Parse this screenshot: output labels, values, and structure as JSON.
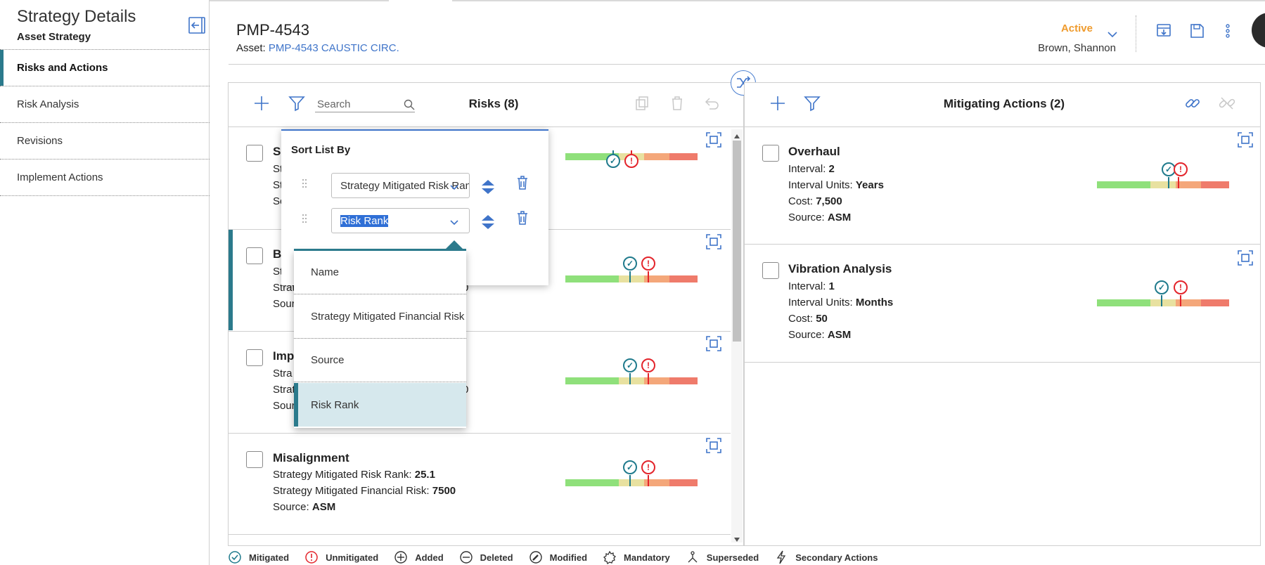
{
  "sidebar": {
    "title": "Strategy Details",
    "subtitle": "Asset Strategy",
    "items": [
      {
        "label": "Risks and Actions",
        "active": true
      },
      {
        "label": "Risk Analysis"
      },
      {
        "label": "Revisions"
      },
      {
        "label": "Implement Actions"
      }
    ]
  },
  "header": {
    "id": "PMP-4543",
    "asset_label": "Asset:",
    "asset_link": "PMP-4543 CAUSTIC CIRC.",
    "status": "Active",
    "owner": "Brown, Shannon"
  },
  "risks": {
    "title": "Risks (8)",
    "search_placeholder": "Search",
    "cards": [
      {
        "title": "S",
        "lines": [
          "Str",
          "Str",
          "Sou"
        ]
      },
      {
        "title": "B",
        "lines": [
          "St",
          "Strat",
          "Sour"
        ],
        "selected": true,
        "trail": [
          "",
          "0",
          ""
        ]
      },
      {
        "title": "Imp",
        "lines": [
          "Stra",
          "Strat",
          "Sour"
        ],
        "trail": [
          "",
          "0",
          ""
        ]
      },
      {
        "title": "Misalignment",
        "lines": [
          {
            "label": "Strategy Mitigated Risk Rank:",
            "value": "25.1"
          },
          {
            "label": "Strategy Mitigated Financial Risk:",
            "value": "7500"
          },
          {
            "label": "Source:",
            "value": "ASM"
          }
        ]
      }
    ]
  },
  "actions": {
    "title": "Mitigating Actions (2)",
    "cards": [
      {
        "title": "Overhaul",
        "lines": [
          {
            "label": "Interval:",
            "value": "2"
          },
          {
            "label": "Interval Units:",
            "value": "Years"
          },
          {
            "label": "Cost:",
            "value": "7,500"
          },
          {
            "label": "Source:",
            "value": "ASM"
          }
        ]
      },
      {
        "title": "Vibration Analysis",
        "lines": [
          {
            "label": "Interval:",
            "value": "1"
          },
          {
            "label": "Interval Units:",
            "value": "Months"
          },
          {
            "label": "Cost:",
            "value": "50"
          },
          {
            "label": "Source:",
            "value": "ASM"
          }
        ]
      }
    ]
  },
  "sort_popup": {
    "title": "Sort List By",
    "field1": "Strategy Mitigated Risk Rank",
    "field2": "Risk Rank",
    "options": [
      "Name",
      "Strategy Mitigated Financial Risk",
      "Source",
      "Risk Rank"
    ],
    "selected_option": "Risk Rank"
  },
  "legend": [
    "Mitigated",
    "Unmitigated",
    "Added",
    "Deleted",
    "Modified",
    "Mandatory",
    "Superseded",
    "Secondary Actions"
  ],
  "colors": {
    "accent": "#2b7a8c",
    "link": "#3f74c9",
    "status": "#ef9b2d",
    "mitigated": "#1f7a8c",
    "unmitigated": "#e3242b",
    "risk_green": "#8fe07b",
    "risk_yellow": "#e8e1a0",
    "risk_orange": "#f4a77a",
    "risk_red": "#ef7b6b"
  }
}
